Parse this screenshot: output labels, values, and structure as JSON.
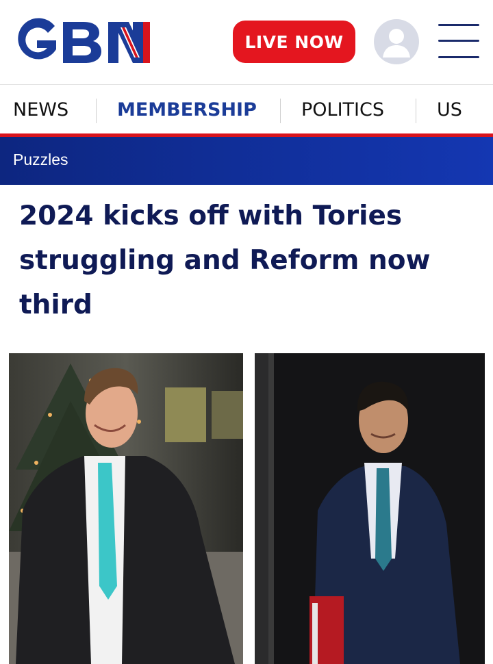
{
  "header": {
    "logo_text": "GBN",
    "live_label": "LIVE NOW",
    "icons": {
      "account": "user-avatar-icon",
      "menu": "hamburger-menu-icon"
    },
    "colors": {
      "brand_blue": "#1b3c98",
      "live_red": "#e4161f"
    }
  },
  "nav": {
    "items": [
      {
        "label": "NEWS",
        "active": false
      },
      {
        "label": "MEMBERSHIP",
        "active": true
      },
      {
        "label": "POLITICS",
        "active": false
      },
      {
        "label": "US",
        "active": false
      }
    ]
  },
  "section": {
    "label": "Puzzles"
  },
  "article": {
    "headline": "2024 kicks off with Tories struggling and Reform now third"
  }
}
